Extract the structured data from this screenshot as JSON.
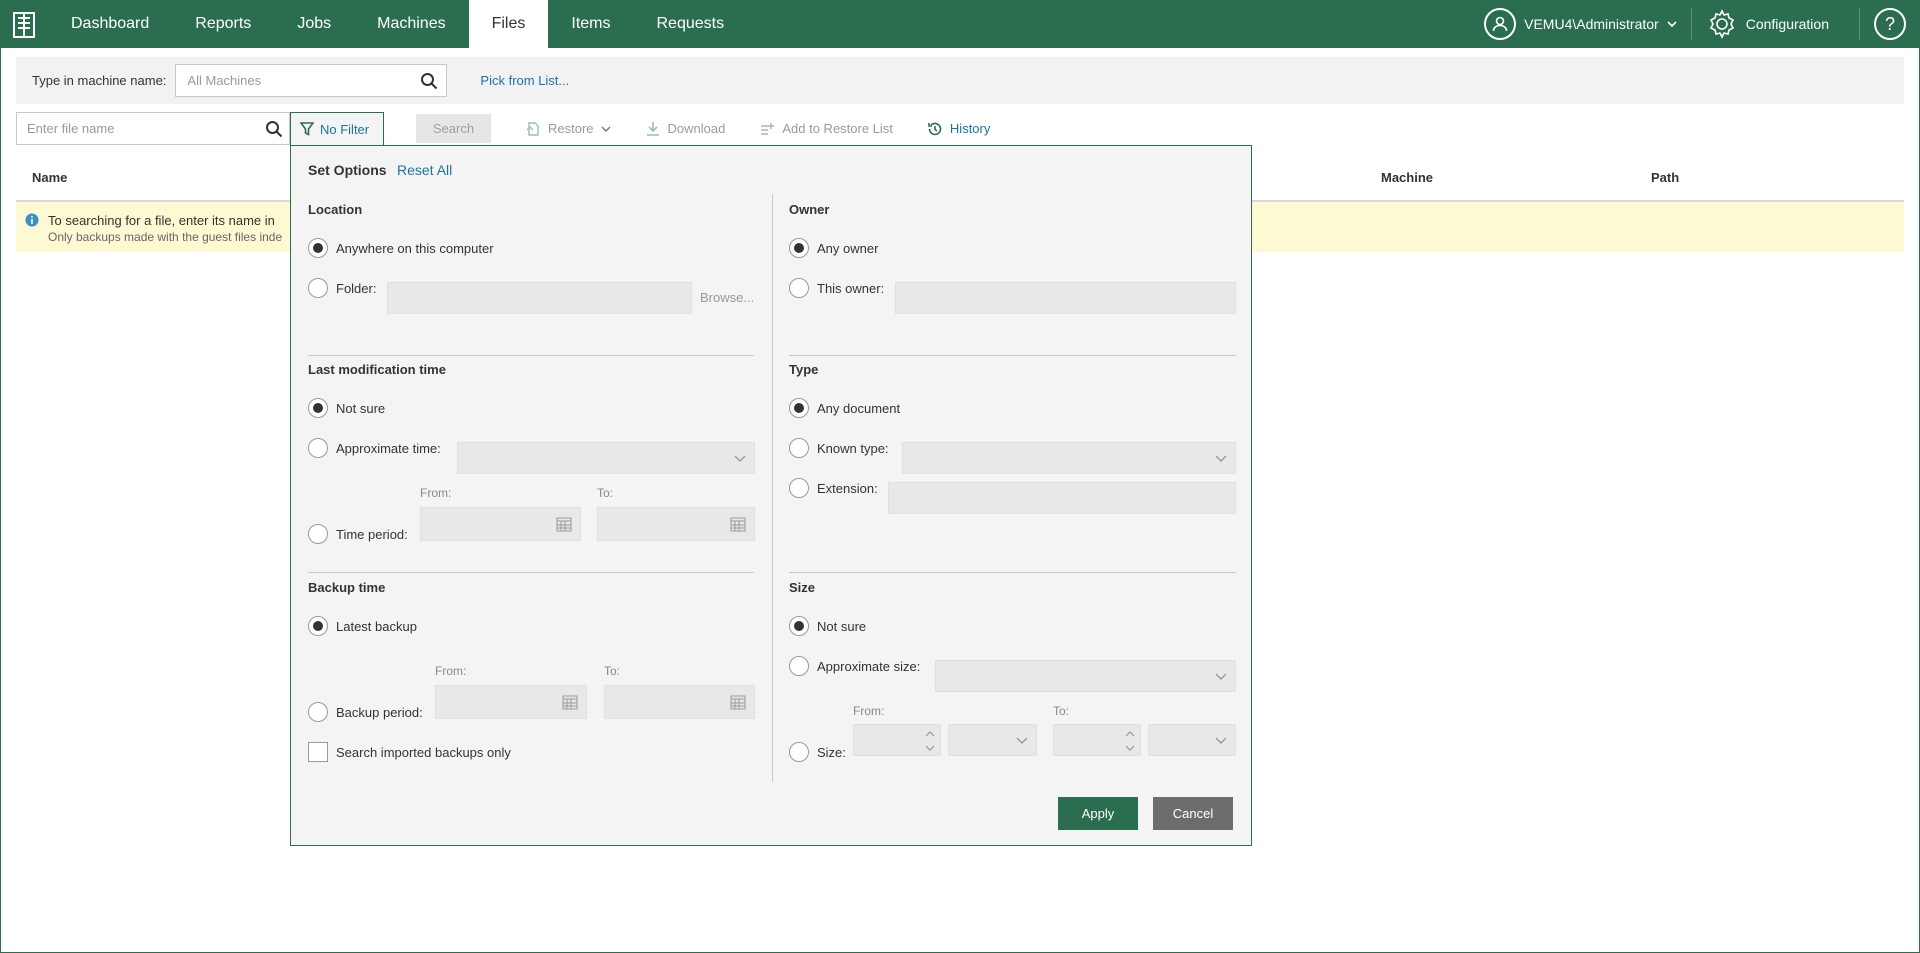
{
  "nav": {
    "items": [
      {
        "label": "Dashboard"
      },
      {
        "label": "Reports"
      },
      {
        "label": "Jobs"
      },
      {
        "label": "Machines"
      },
      {
        "label": "Files"
      },
      {
        "label": "Items"
      },
      {
        "label": "Requests"
      }
    ],
    "active": "Files",
    "user": "VEMU4\\Administrator",
    "configuration": "Configuration",
    "help": "?"
  },
  "machine": {
    "label": "Type in machine name:",
    "placeholder": "All Machines",
    "pick_link": "Pick from List..."
  },
  "toolbar": {
    "file_placeholder": "Enter file name",
    "filter": "No Filter",
    "search": "Search",
    "restore": "Restore",
    "download": "Download",
    "add_to_restore": "Add to Restore List",
    "history": "History"
  },
  "table": {
    "columns": {
      "name": "Name",
      "machine": "Machine",
      "path": "Path"
    },
    "info_line1": "To searching for a file, enter its name in",
    "info_line2": "Only backups made with the guest files inde"
  },
  "filter_panel": {
    "title": "Set Options",
    "reset": "Reset All",
    "location": {
      "title": "Location",
      "anywhere": "Anywhere on this computer",
      "folder": "Folder:",
      "browse": "Browse..."
    },
    "owner": {
      "title": "Owner",
      "any": "Any owner",
      "this": "This owner:"
    },
    "modification": {
      "title": "Last modification time",
      "not_sure": "Not sure",
      "approx": "Approximate time:",
      "period": "Time period:",
      "from": "From:",
      "to": "To:"
    },
    "type": {
      "title": "Type",
      "any": "Any document",
      "known": "Known type:",
      "extension": "Extension:"
    },
    "backup_time": {
      "title": "Backup time",
      "latest": "Latest backup",
      "period": "Backup period:",
      "from": "From:",
      "to": "To:",
      "imported": "Search imported backups only"
    },
    "size": {
      "title": "Size",
      "not_sure": "Not sure",
      "approx": "Approximate size:",
      "size": "Size:",
      "from": "From:",
      "to": "To:"
    },
    "apply": "Apply",
    "cancel": "Cancel"
  }
}
